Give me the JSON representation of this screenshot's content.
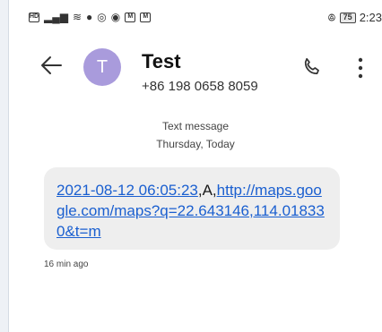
{
  "status_bar": {
    "time": "2:23",
    "battery": "75"
  },
  "header": {
    "avatar_letter": "T",
    "contact_name": "Test",
    "contact_number": "+86 198 0658 8059"
  },
  "thread": {
    "message_type": "Text message",
    "date": "Thursday, Today",
    "messages": [
      {
        "part1": "2021-08-12 06:05:23",
        "part2": ",A,",
        "part3": "http://maps.google.com/maps?q=22.643146,114.018330&t=m",
        "time_ago": "16 min ago"
      }
    ]
  },
  "colors": {
    "avatar": "#a99bdc",
    "link": "#1a5fd0",
    "bubble": "#eeeeee"
  },
  "icons": [
    "back-arrow-icon",
    "phone-icon",
    "more-vertical-icon"
  ]
}
